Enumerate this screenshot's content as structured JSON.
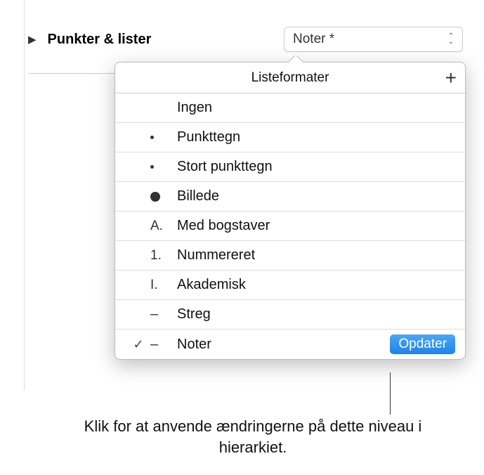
{
  "header": {
    "label": "Punkter & lister",
    "dropdown_value": "Noter *"
  },
  "popover": {
    "title": "Listeformater",
    "add_symbol": "+"
  },
  "formats": [
    {
      "checked": false,
      "marker_type": "none",
      "marker": "",
      "label": "Ingen"
    },
    {
      "checked": false,
      "marker_type": "dot-small",
      "marker": "",
      "label": "Punkttegn"
    },
    {
      "checked": false,
      "marker_type": "dot-small",
      "marker": "",
      "label": "Stort punkttegn"
    },
    {
      "checked": false,
      "marker_type": "dot-large",
      "marker": "",
      "label": "Billede"
    },
    {
      "checked": false,
      "marker_type": "text",
      "marker": "A.",
      "label": "Med bogstaver"
    },
    {
      "checked": false,
      "marker_type": "text",
      "marker": "1.",
      "label": "Nummereret"
    },
    {
      "checked": false,
      "marker_type": "text",
      "marker": "I.",
      "label": "Akademisk"
    },
    {
      "checked": false,
      "marker_type": "dash",
      "marker": "–",
      "label": "Streg"
    },
    {
      "checked": true,
      "marker_type": "dash",
      "marker": "–",
      "label": "Noter",
      "update": true
    }
  ],
  "update_label": "Opdater",
  "callout": "Klik for at anvende ændringerne på dette niveau i hierarkiet."
}
